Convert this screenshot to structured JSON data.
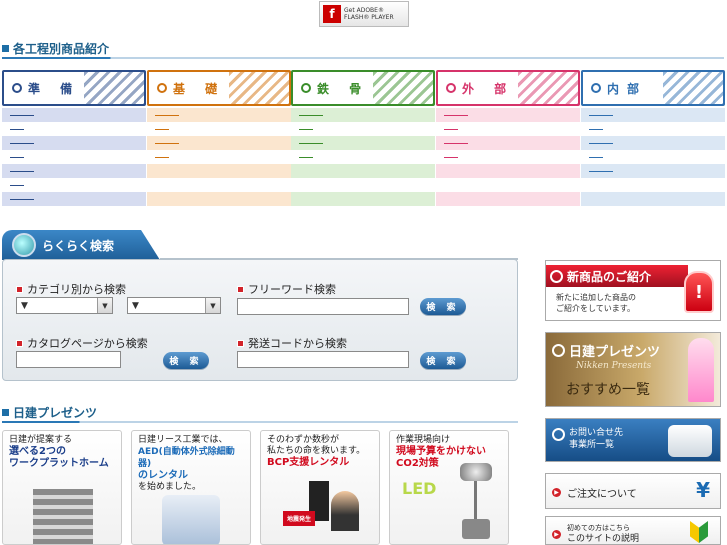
{
  "flash_badge": {
    "line1": "Get ADOBE®",
    "line2": "FLASH® PLAYER",
    "logo": "f"
  },
  "section_products": {
    "title": "各工程別商品紹介"
  },
  "categories": [
    {
      "label": "準 備",
      "color": "#2b4d8a",
      "bg": "#d6dcf0"
    },
    {
      "label": "基 礎",
      "color": "#d0720e",
      "bg": "#fbe6cf"
    },
    {
      "label": "鉄 骨",
      "color": "#3a8d2a",
      "bg": "#dcefd5"
    },
    {
      "label": "外 部",
      "color": "#d6336a",
      "bg": "#fbdde6"
    },
    {
      "label": "内部",
      "color": "#2f6fb0",
      "bg": "#dbe7f4"
    }
  ],
  "search": {
    "tab_label": "らくらく検索",
    "category_label": "カテゴリ別から検索",
    "select1": "▼",
    "select2": "▼",
    "freeword_label": "フリーワード検索",
    "freeword_button": "検 索",
    "catalog_label": "カタログページから検索",
    "catalog_button": "検 索",
    "shipping_label": "発送コードから検索",
    "shipping_button": "検 索"
  },
  "right_banners": {
    "new_products": {
      "title": "新商品のご紹介",
      "line1": "新たに追加した商品の",
      "line2": "ご紹介をしています。"
    },
    "presents": {
      "title": "日建プレゼンツ",
      "subtitle": "Nikken Presents",
      "caption": "おすすめ一覧"
    },
    "contact": {
      "line1": "お問い合せ先",
      "line2": "事業所一覧"
    },
    "order": {
      "label": "ご注文について"
    },
    "guide": {
      "line1": "初めての方はこちら",
      "line2": "このサイトの説明"
    }
  },
  "section_presents": {
    "title": "日建プレゼンツ"
  },
  "cards": [
    {
      "t1": "日建が提案する",
      "t2": "選べる2つの",
      "t3": "ワークプラットホーム",
      "t3color": "#1c3f8a"
    },
    {
      "t1": "日建リース工業では、",
      "t2": "AED(自動体外式除細動器)",
      "t3": "のレンタル",
      "t4": "を始めました。"
    },
    {
      "t1": "そのわずか数秒が",
      "t2": "私たちの命を救います。",
      "t3": "BCP支援レンタル",
      "badge": "地震発生"
    },
    {
      "t1": "作業現場向け",
      "t2": "現場予算をかけない",
      "t3": "CO2対策",
      "logo": "LED"
    }
  ]
}
